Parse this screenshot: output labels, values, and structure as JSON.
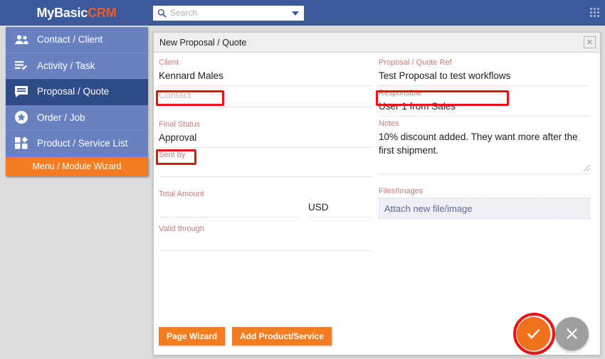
{
  "app": {
    "brand_prefix": "MyBasic",
    "brand_accent": "CRM",
    "brand_color": "#f05a23",
    "header_color": "#3c5a9a",
    "apps_grid_icon": "grid-apps-icon"
  },
  "search": {
    "placeholder": "Search",
    "value": "",
    "icon": "search-icon",
    "dropdown_icon": "chevron-down-icon"
  },
  "sidebar": {
    "items": [
      {
        "label": "Contact / Client",
        "icon": "people-icon",
        "active": false
      },
      {
        "label": "Activity / Task",
        "icon": "task-list-check-icon",
        "active": false
      },
      {
        "label": "Proposal / Quote",
        "icon": "chat-bubble-icon",
        "active": true
      },
      {
        "label": "Order / Job",
        "icon": "star-circle-icon",
        "active": false
      },
      {
        "label": "Product / Service List",
        "icon": "grid-box-icon",
        "active": false
      }
    ],
    "wizard_button": "Menu / Module Wizard",
    "active_color": "#2e4a87",
    "item_color": "#6881c0",
    "wizard_color": "#f57c20"
  },
  "panel": {
    "title": "New Proposal / Quote",
    "close_icon": "close-icon",
    "left_fields": [
      {
        "label": "Client",
        "value": "Kennard Males",
        "type": "text",
        "highlighted": true
      },
      {
        "label": "Contact",
        "value": "",
        "type": "placeholder",
        "placeholder": "Contact",
        "highlighted": false
      },
      {
        "label": "Final Status",
        "value": "Approval",
        "type": "text",
        "highlighted": true
      },
      {
        "label": "Sent by",
        "value": "",
        "type": "text",
        "highlighted": false
      }
    ],
    "amount": {
      "label": "Total Amount",
      "value": "",
      "currency": "USD"
    },
    "valid_through": {
      "label": "Valid through",
      "value": ""
    },
    "right_fields": [
      {
        "label": "Proposal / Quote Ref",
        "value": "Test Proposal to test workflows",
        "highlighted": true
      },
      {
        "label": "Responsible",
        "value": "User 1 from Sales",
        "highlighted": false
      }
    ],
    "notes": {
      "label": "Notes",
      "value": "10% discount added. They want more after the first shipment."
    },
    "files": {
      "label": "Files/Images",
      "attach_text": "Attach new file/image"
    },
    "footer": {
      "page_wizard": "Page Wizard",
      "add_product": "Add Product/Service",
      "save_icon": "checkmark-icon",
      "cancel_icon": "close-x-icon",
      "save_color": "#f2711c",
      "cancel_color": "#9e9e9e"
    },
    "annotation_color": "#ee1111"
  }
}
